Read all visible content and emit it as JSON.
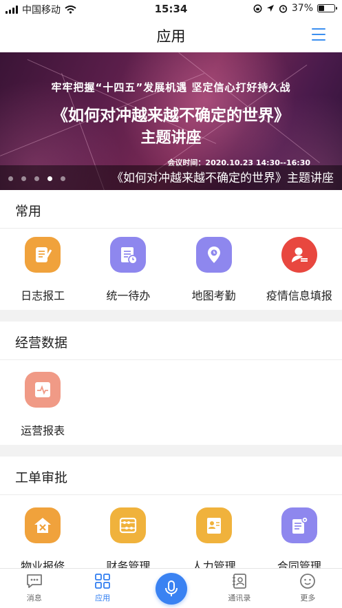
{
  "status_bar": {
    "carrier": "中国移动",
    "time": "15:34",
    "battery": "37%",
    "battery_level": 0.37
  },
  "header": {
    "title": "应用",
    "menu_icon": "menu-icon"
  },
  "banner": {
    "top_text": "牢牢把握“十四五”发展机遇 坚定信心打好持久战",
    "main_title": "《如何对冲越来越不确定的世界》",
    "sub_title": "主题讲座",
    "meeting_time": "会议时间：2020.10.23  14:30--16:30",
    "caption": "《如何对冲越来越不确定的世界》主题讲座",
    "slide_count": 5,
    "active_slide": 4,
    "colors": {
      "bg": "#5a1e4a"
    }
  },
  "sections": {
    "common": {
      "title": "常用",
      "items": [
        {
          "label": "日志报工",
          "icon": "notebook-pen-icon",
          "color": "#f0a23c"
        },
        {
          "label": "统一待办",
          "icon": "document-clock-icon",
          "color": "#8e87ee"
        },
        {
          "label": "地图考勤",
          "icon": "map-pin-icon",
          "color": "#8e87ee"
        },
        {
          "label": "疫情信息填报",
          "icon": "person-list-icon",
          "color": "#e8473f"
        }
      ]
    },
    "business": {
      "title": "经营数据",
      "items": [
        {
          "label": "运营报表",
          "icon": "report-chart-icon",
          "color": "#f09a86"
        }
      ]
    },
    "workorder": {
      "title": "工单审批",
      "items": [
        {
          "label": "物业报修",
          "icon": "house-tools-icon",
          "color": "#f0a23c"
        },
        {
          "label": "财务管理",
          "icon": "abacus-icon",
          "color": "#f0b23c"
        },
        {
          "label": "人力管理",
          "icon": "id-card-icon",
          "color": "#f0b23c"
        },
        {
          "label": "合同管理",
          "icon": "contract-gear-icon",
          "color": "#8e87ee"
        }
      ]
    }
  },
  "tabbar": {
    "items": [
      {
        "label": "消息",
        "icon": "message-icon"
      },
      {
        "label": "应用",
        "icon": "apps-grid-icon",
        "active": true
      },
      {
        "label": "",
        "icon": "microphone-icon"
      },
      {
        "label": "通讯录",
        "icon": "contacts-icon"
      },
      {
        "label": "更多",
        "icon": "more-icon"
      }
    ],
    "colors": {
      "active": "#2f7df1",
      "inactive": "#666666",
      "mic": "#3a82f2"
    }
  }
}
